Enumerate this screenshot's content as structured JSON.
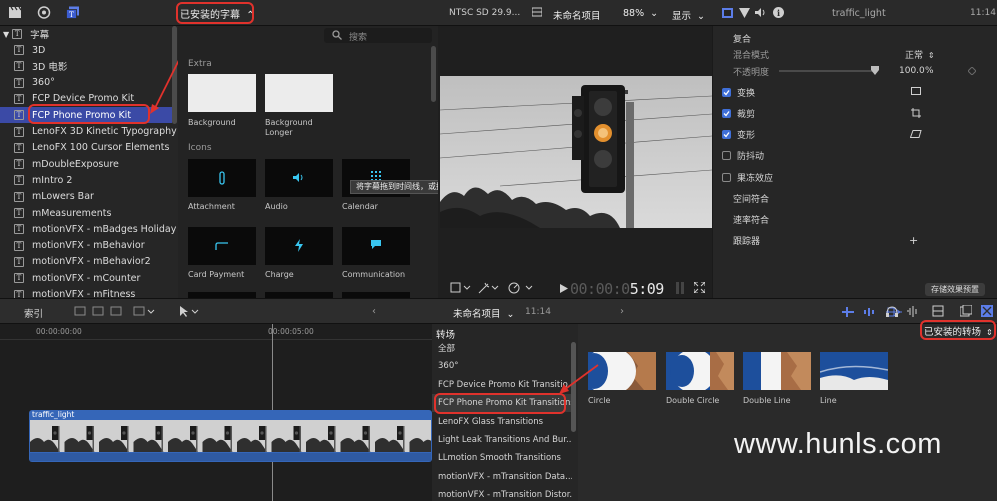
{
  "top_bar": {
    "browser_filter": "已安装的字幕",
    "format": "NTSC SD 29.9...",
    "project_name": "未命名项目",
    "zoom": "88%",
    "view_menu": "显示",
    "inspector_title": "traffic_light",
    "timecode_end": "11:14"
  },
  "sidebar": {
    "root_label": "字幕",
    "items": [
      "3D",
      "3D 电影",
      "360°",
      "FCP Device Promo Kit",
      "FCP Phone Promo Kit",
      "LenoFX 3D Kinetic Typography",
      "LenoFX 100 Cursor Elements",
      "mDoubleExposure",
      "mIntro 2",
      "mLowers Bar",
      "mMeasurements",
      "motionVFX - mBadges Holiday",
      "motionVFX - mBehavior",
      "motionVFX - mBehavior2",
      "motionVFX - mCounter",
      "motionVFX - mFitness"
    ]
  },
  "browser": {
    "search_placeholder": "搜索",
    "section_extra": "Extra",
    "section_icons": "Icons",
    "extra_items": [
      "Background",
      "Background Longer"
    ],
    "icon_items": [
      "Attachment",
      "Audio",
      "Calendar",
      "Card Payment",
      "Charge",
      "Communication"
    ],
    "tooltip": "将字幕拖到时间线，或拖到片段的开头、中间或结尾"
  },
  "viewer": {
    "timecode_dim": "00:00:0",
    "timecode_bright": "5:09"
  },
  "inspector": {
    "composite": "复合",
    "blend_mode_label": "混合模式",
    "blend_mode_value": "正常",
    "opacity_label": "不透明度",
    "opacity_value": "100.0",
    "opacity_unit": "%",
    "rows": [
      {
        "label": "变换",
        "checked": true
      },
      {
        "label": "裁剪",
        "checked": true
      },
      {
        "label": "变形",
        "checked": true
      },
      {
        "label": "防抖动",
        "checked": false
      },
      {
        "label": "果冻效应",
        "checked": false
      }
    ],
    "spatial_conform": "空间符合",
    "rate_conform": "速率符合",
    "tracker": "跟踪器",
    "save_preset": "存储效果预置"
  },
  "timeline_toolbar": {
    "index": "索引",
    "project_name": "未命名项目",
    "duration": "11:14"
  },
  "timeline": {
    "ruler_start": "00:00:00:00",
    "ruler_mid": "00:00:05:00",
    "clip_name": "traffic_light"
  },
  "transitions": {
    "header": "转场",
    "items": [
      "全部",
      "360°",
      "FCP Device Promo Kit Transitio...",
      "FCP Phone Promo Kit Transitions",
      "LenoFX Glass Transitions",
      "Light Leak Transitions And Bur...",
      "LLmotion Smooth Transitions",
      "motionVFX - mTransition Data...",
      "motionVFX - mTransition Distor..."
    ],
    "filter": "已安装的转场",
    "thumbs": [
      "Circle",
      "Double Circle",
      "Double Line",
      "Line"
    ]
  },
  "watermark": "www.hunls.com",
  "colors": {
    "accent": "#3b4aa6",
    "highlight_red": "#e0322c",
    "checkbox_blue": "#3f6fd8"
  }
}
